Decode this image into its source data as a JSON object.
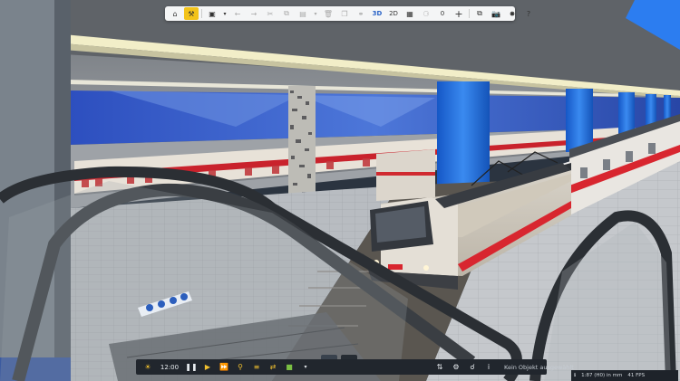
{
  "toolbar": {
    "counter": "0",
    "view_3d": "3D",
    "view_2d": "2D",
    "icons": [
      "home-icon",
      "tools-icon",
      "save-icon",
      "chevron-down-icon",
      "undo-icon",
      "redo-icon",
      "cut-icon",
      "copy-icon",
      "paste-icon",
      "chevron-down-icon",
      "delete-icon",
      "duplicate-icon",
      "link-icon",
      "grid-icon",
      "marker-icon",
      "plus-icon",
      "layers-icon",
      "camera-icon",
      "plugin-icon",
      "help-icon"
    ],
    "active_tool": "tools-icon"
  },
  "bottombar": {
    "time": "12:00",
    "status": "Kein Objekt ausgewählt"
  },
  "statusbar": {
    "scale": "1:87 (H0) in mm",
    "fps": "41 FPS"
  },
  "colors": {
    "toolbar_bg": "#f4f5f6",
    "active_accent": "#f3c31a",
    "bar_bg": "#21262d",
    "train_stripe": "#d8262f",
    "pillar_blue": "#1f6fd8"
  }
}
